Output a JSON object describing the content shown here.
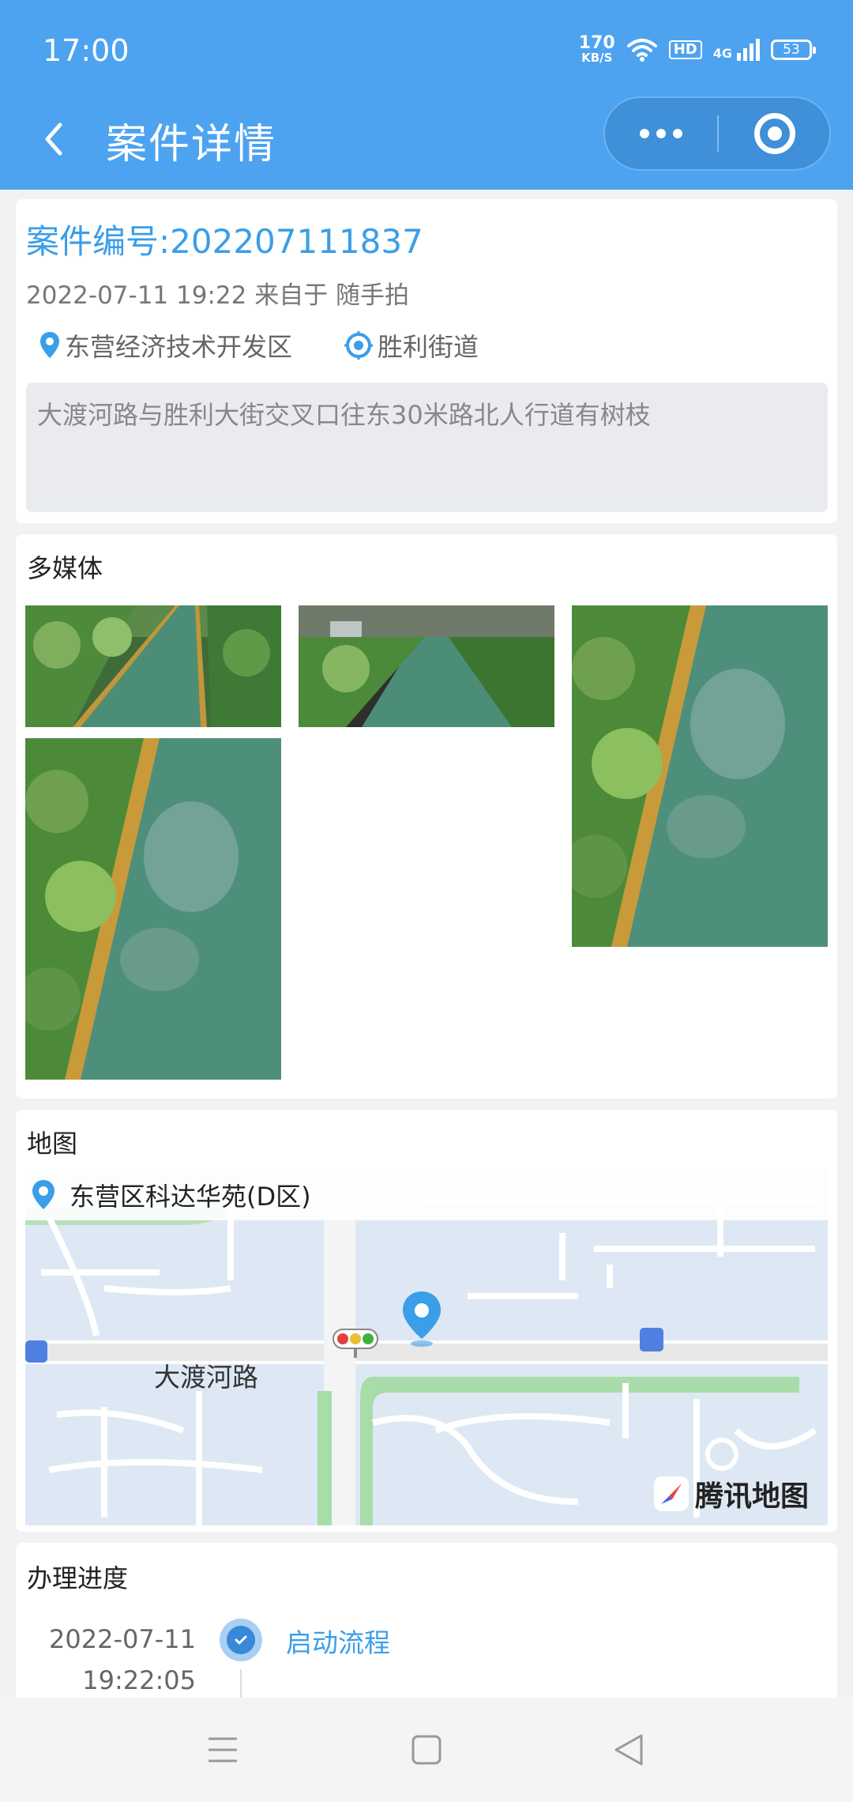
{
  "status_bar": {
    "time": "17:00",
    "net_speed_value": "170",
    "net_speed_unit": "KB/S",
    "hd_label": "HD",
    "network_label": "4G",
    "battery": "53"
  },
  "header": {
    "title": "案件详情"
  },
  "case": {
    "number": "案件编号:202207111837",
    "meta": "2022-07-11 19:22 来自于 随手拍",
    "district": "东营经济技术开发区",
    "street": "胜利街道",
    "description": "大渡河路与胜利大街交叉口往东30米路北人行道有树枝"
  },
  "media": {
    "label": "多媒体"
  },
  "map": {
    "label": "地图",
    "address": "东营区科达华苑(D区)",
    "road_label": "大渡河路",
    "provider": "腾讯地图"
  },
  "progress": {
    "label": "办理进度",
    "steps": [
      {
        "date": "2022-07-11",
        "time": "19:22:05",
        "action": "启动流程"
      }
    ]
  },
  "colors": {
    "header_bg": "#4da3f0",
    "accent": "#3a9ee8"
  }
}
